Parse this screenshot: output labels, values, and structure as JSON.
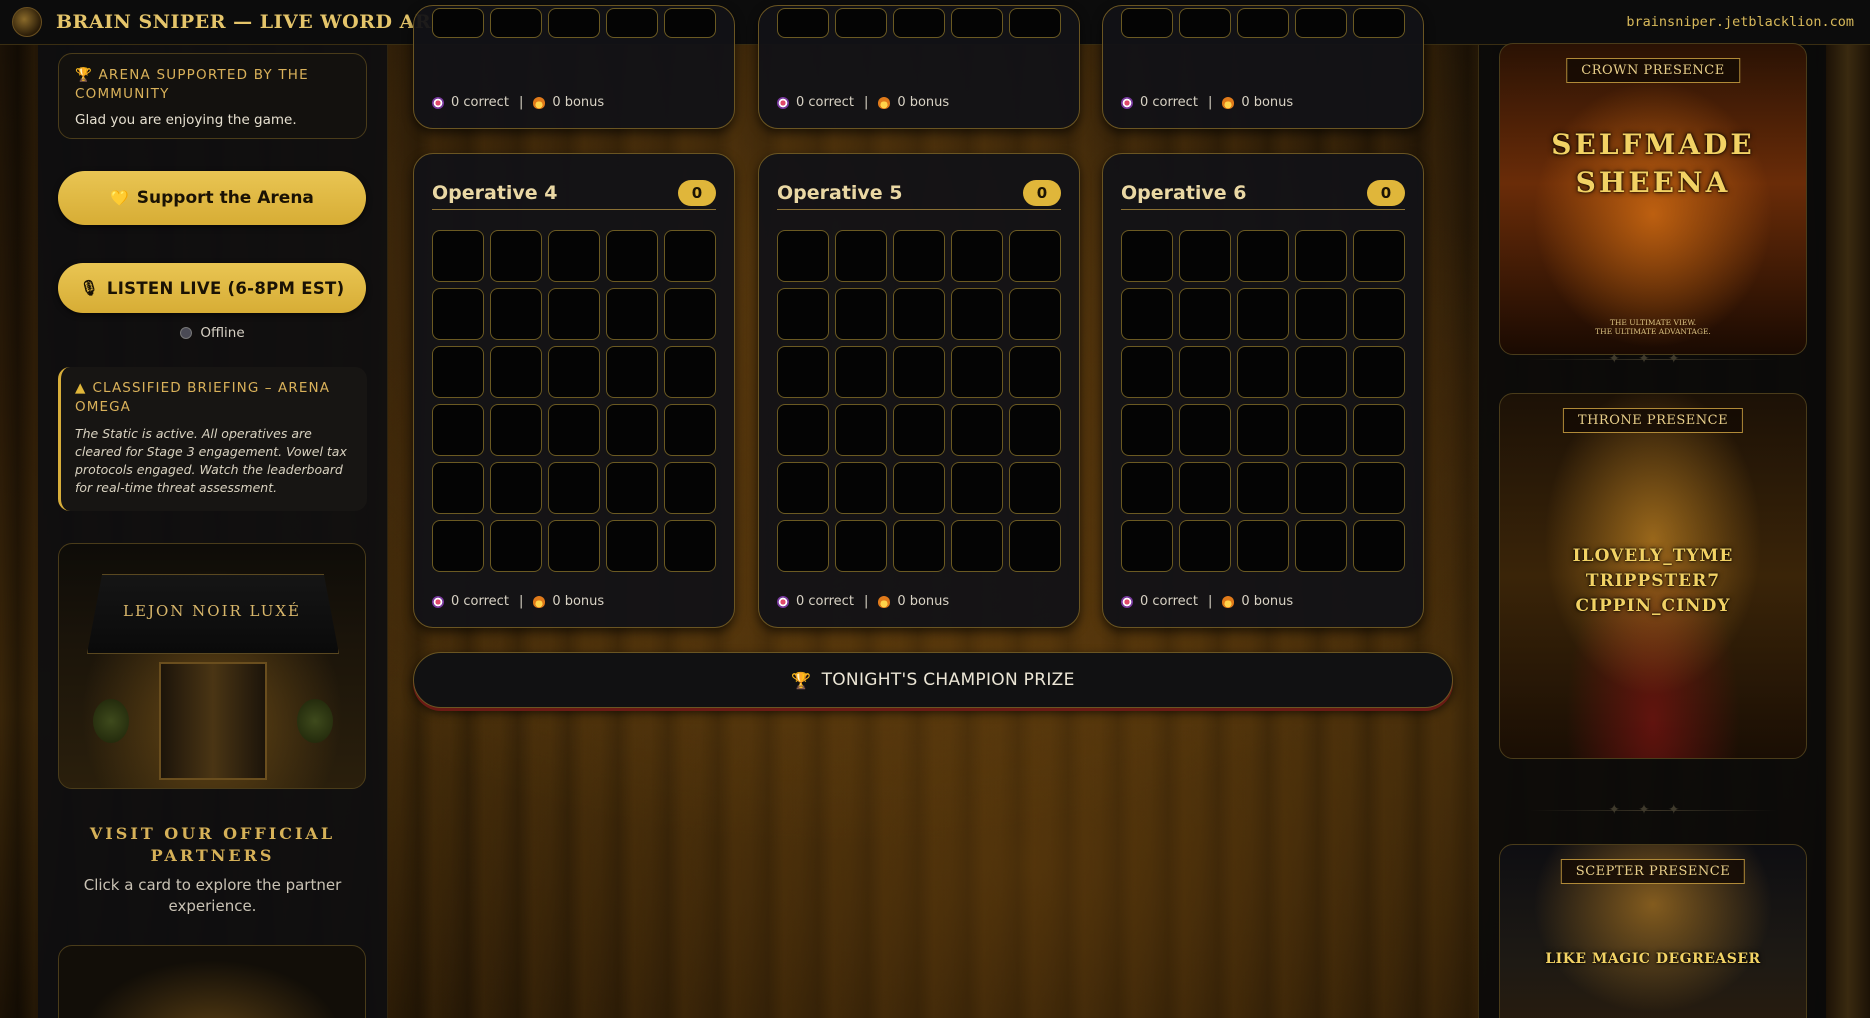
{
  "topbar": {
    "title": "BRAIN SNIPER — LIVE WORD ARENA",
    "domain": "brainsniper.jetblacklion.com"
  },
  "sidebar": {
    "support_card": {
      "heading": "🏆 ARENA SUPPORTED BY THE COMMUNITY",
      "subtext": "Glad you are enjoying the game."
    },
    "support_button": "Support the Arena",
    "listen_button": "LISTEN LIVE (6-8PM EST)",
    "live_status": "Offline",
    "briefing": {
      "heading": "CLASSIFIED BRIEFING – ARENA OMEGA",
      "body": "The Static is active. All operatives are cleared for Stage 3 engagement. Vowel tax protocols engaged. Watch the leaderboard for real-time threat assessment."
    },
    "lejon_brand": "LEJON NOIR LUXÉ",
    "partners_title": "VISIT OUR OFFICIAL PARTNERS",
    "partners_sub": "Click a card to explore the partner experience."
  },
  "operatives_top": [
    {
      "correct": "0 correct",
      "bonus": "0 bonus"
    },
    {
      "correct": "0 correct",
      "bonus": "0 bonus"
    },
    {
      "correct": "0 correct",
      "bonus": "0 bonus"
    }
  ],
  "operatives": [
    {
      "name": "Operative 4",
      "score": "0",
      "correct": "0 correct",
      "bonus": "0 bonus"
    },
    {
      "name": "Operative 5",
      "score": "0",
      "correct": "0 correct",
      "bonus": "0 bonus"
    },
    {
      "name": "Operative 6",
      "score": "0",
      "correct": "0 correct",
      "bonus": "0 bonus"
    }
  ],
  "prize_bar": "TONIGHT'S CHAMPION PRIZE",
  "rightbar": {
    "crown": {
      "ribbon": "CROWN PRESENCE",
      "names": [
        "SELFMADE",
        "SHEENA"
      ],
      "tagline": [
        "THE ULTIMATE VIEW.",
        "THE ULTIMATE ADVANTAGE."
      ]
    },
    "throne": {
      "ribbon": "THRONE PRESENCE",
      "names": [
        "ILOVELY_TYME",
        "TRIPPSTER7",
        "CIPPIN_CINDY"
      ]
    },
    "scepter": {
      "ribbon": "SCEPTER PRESENCE",
      "names": [
        "LIKE MAGIC DEGREASER"
      ]
    }
  },
  "colors": {
    "gold": "#e0b63a",
    "accent_text": "#d9b15a",
    "card_bg": "#121216",
    "cell_border": "#6b5a22"
  },
  "icons": [
    "logo-icon",
    "trophy-icon",
    "heart-icon",
    "microphone-icon",
    "status-dot-icon",
    "warning-icon",
    "target-icon",
    "fire-icon"
  ]
}
